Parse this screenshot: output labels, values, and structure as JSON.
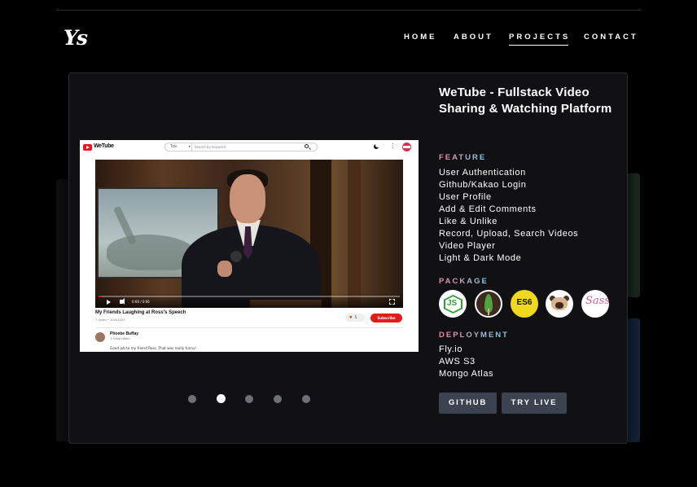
{
  "header": {
    "logo_text": "Ys",
    "nav": [
      {
        "label": "HOME",
        "active": false
      },
      {
        "label": "ABOUT",
        "active": false
      },
      {
        "label": "PROJECTS",
        "active": true
      },
      {
        "label": "CONTACT",
        "active": false
      }
    ]
  },
  "modal": {
    "screenshot": {
      "site_name": "WeTube",
      "search_select": "Title",
      "search_placeholder": "Search by keyword",
      "video_time": "0:00 / 0:06",
      "video_title": "My Friends Laughing at Ross's Speech",
      "video_meta": "7 views • 10/4/2023",
      "like_count": "5",
      "subscribe_label": "Subscribe",
      "channel_name": "Phoebe Buffay",
      "channel_subs": "1 Subscribers",
      "comment_text": "Good job to my friend Ross. That was really funny!",
      "progress_fraction": 0.01
    },
    "carousel": {
      "count": 5,
      "active_index": 1
    },
    "project_title": "WeTube - Fullstack Video Sharing & Watching Platform",
    "feature_heading": "FEATURE",
    "features": [
      "User Authentication",
      "Github/Kakao Login",
      "User Profile",
      "Add & Edit Comments",
      "Like & Unlike",
      "Record, Upload, Search Videos",
      "Video Player",
      "Light & Dark Mode"
    ],
    "package_heading": "PACKAGE",
    "packages": [
      {
        "icon": "nodejs-icon",
        "text": "JS"
      },
      {
        "icon": "mongodb-icon",
        "text": ""
      },
      {
        "icon": "es6-icon",
        "text": "ES6"
      },
      {
        "icon": "pug-icon",
        "text": ""
      },
      {
        "icon": "sass-icon",
        "text": "Sass"
      }
    ],
    "deployment_heading": "DEPLOYMENT",
    "deployments": [
      "Fly.io",
      "AWS S3",
      "Mongo Atlas"
    ],
    "buttons": {
      "github": "GITHUB",
      "try_live": "TRY LIVE"
    }
  },
  "colors": {
    "background": "#000000",
    "modal": "#111113",
    "button": "#3b4250",
    "heading_gradient_start": "#f3869a",
    "heading_gradient_end": "#7fd1f0",
    "youtube_red": "#e21a1a"
  }
}
